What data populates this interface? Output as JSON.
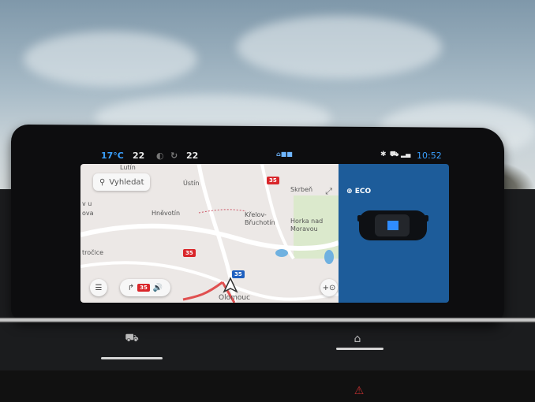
{
  "status_bar": {
    "temp_left": "17°C",
    "fan_left": "22",
    "fan_right": "22",
    "time": "10:52",
    "right_icons": [
      "bluetooth-icon",
      "car-icon",
      "signal-icon"
    ]
  },
  "map": {
    "search_placeholder": "Vyhledat",
    "places": {
      "lutin": "Lutín",
      "ustin": "Ústín",
      "skrbenn": "Skrbeň",
      "v_u": "v u",
      "ova": "ova",
      "hnevotin": "Hněvotín",
      "krelov": "Křelov-\nBřuchotín",
      "horka": "Horka nad\nMoravou",
      "trocice": "tročice",
      "olomouc": "Olomouc"
    },
    "road_badges": {
      "r35_top": "35",
      "r35_mid": "35",
      "r35_blue": "35",
      "r35_bottom": "35"
    }
  },
  "side_panel": {
    "mode_label": "ECO"
  },
  "colors": {
    "panel_blue": "#1d5c9a",
    "map_bg": "#ece8e6",
    "accent_red": "#d9262a"
  }
}
